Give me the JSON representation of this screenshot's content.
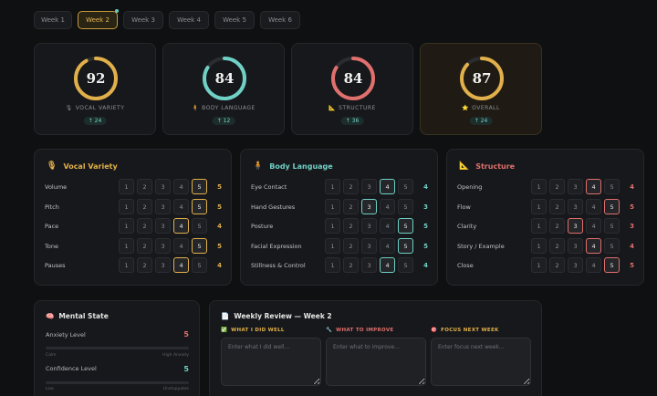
{
  "weeks": [
    "Week 1",
    "Week 2",
    "Week 3",
    "Week 4",
    "Week 5",
    "Week 6"
  ],
  "active_week_index": 1,
  "scores": [
    {
      "value": "92",
      "label": "VOCAL VARIETY",
      "icon": "microphone-icon",
      "glyph": "🎙",
      "delta": "↑ 24",
      "color": "#e1b04a",
      "progress": 0.92
    },
    {
      "value": "84",
      "label": "BODY LANGUAGE",
      "icon": "person-icon",
      "glyph": "🧍",
      "delta": "↑ 12",
      "color": "#6fd0c5",
      "progress": 0.84
    },
    {
      "value": "84",
      "label": "STRUCTURE",
      "icon": "ruler-icon",
      "glyph": "📐",
      "delta": "↑ 36",
      "color": "#e0706d",
      "progress": 0.84
    },
    {
      "value": "87",
      "label": "OVERALL",
      "icon": "star-icon",
      "glyph": "⭐",
      "delta": "↑ 24",
      "color": "#e1b04a",
      "progress": 0.87
    }
  ],
  "panels": [
    {
      "title": "Vocal Variety",
      "icon": "microphone-icon",
      "glyph": "🎙",
      "color": "#e1b04a",
      "rows": [
        {
          "label": "Volume",
          "value": 5
        },
        {
          "label": "Pitch",
          "value": 5
        },
        {
          "label": "Pace",
          "value": 4
        },
        {
          "label": "Tone",
          "value": 5
        },
        {
          "label": "Pauses",
          "value": 4
        }
      ]
    },
    {
      "title": "Body Language",
      "icon": "person-icon",
      "glyph": "🧍",
      "color": "#6fd0c5",
      "rows": [
        {
          "label": "Eye Contact",
          "value": 4
        },
        {
          "label": "Hand Gestures",
          "value": 3
        },
        {
          "label": "Posture",
          "value": 5
        },
        {
          "label": "Facial Expression",
          "value": 5
        },
        {
          "label": "Stillness & Control",
          "value": 4
        }
      ]
    },
    {
      "title": "Structure",
      "icon": "ruler-icon",
      "glyph": "📐",
      "color": "#e0706d",
      "rows": [
        {
          "label": "Opening",
          "value": 4
        },
        {
          "label": "Flow",
          "value": 5
        },
        {
          "label": "Clarity",
          "value": 3
        },
        {
          "label": "Story / Example",
          "value": 4
        },
        {
          "label": "Close",
          "value": 5
        }
      ]
    }
  ],
  "rating_scale": [
    "1",
    "2",
    "3",
    "4",
    "5"
  ],
  "mental": {
    "title": "Mental State",
    "glyph": "🧠",
    "anxiety": {
      "label": "Anxiety Level",
      "value": "5",
      "color": "#e0706d",
      "low": "Calm",
      "high": "High Anxiety"
    },
    "confidence": {
      "label": "Confidence Level",
      "value": "5",
      "color": "#6fd0c5",
      "low": "Low",
      "high": "Unstoppable"
    }
  },
  "review": {
    "title": "Weekly Review — Week 2",
    "glyph": "📄",
    "columns": [
      {
        "heading": "WHAT I DID WELL",
        "glyph": "✅",
        "color": "#e1b04a",
        "placeholder": "Enter what I did well..."
      },
      {
        "heading": "WHAT TO IMPROVE",
        "glyph": "🔧",
        "color": "#e0706d",
        "placeholder": "Enter what to improve..."
      },
      {
        "heading": "FOCUS NEXT WEEK",
        "glyph": "🎯",
        "color": "#e1b04a",
        "placeholder": "Enter focus next week..."
      }
    ]
  }
}
